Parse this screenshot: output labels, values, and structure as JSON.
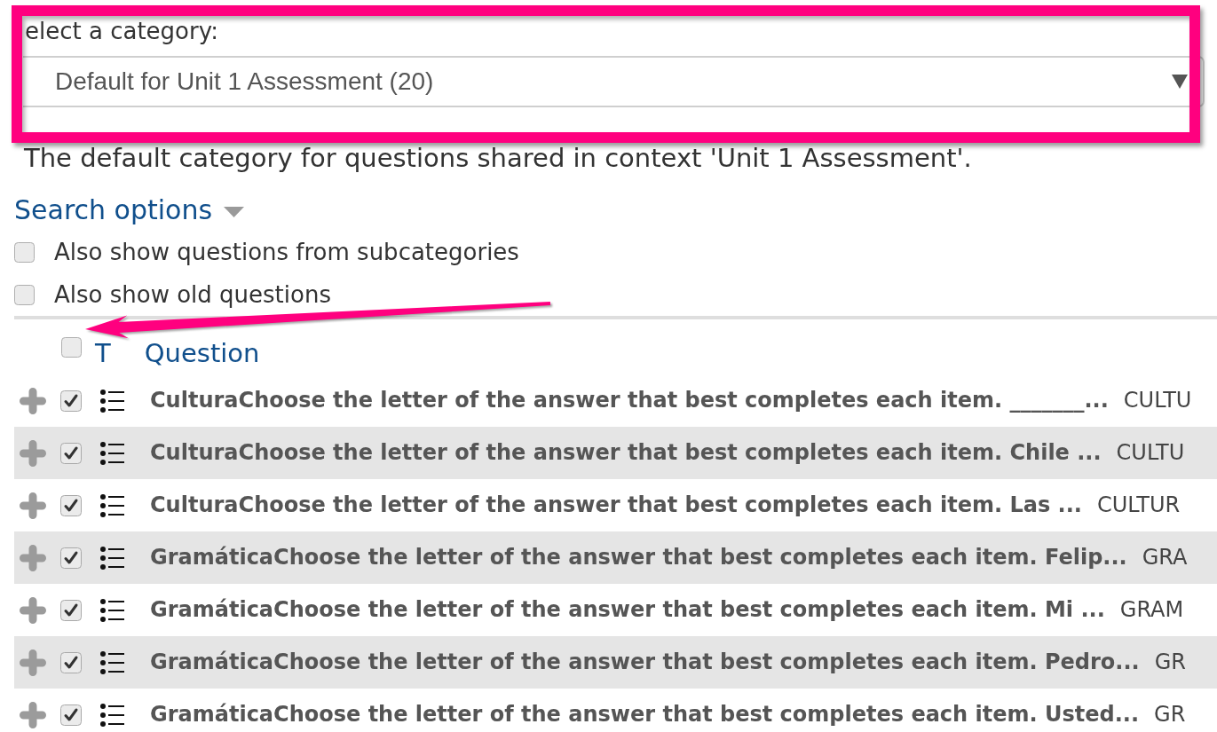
{
  "category_select": {
    "label": "elect a category:",
    "value": "Default for Unit 1 Assessment (20)",
    "highlighted": true
  },
  "category_description": "The default category for questions shared in context 'Unit 1 Assessment'.",
  "search_options": {
    "label": "Search options",
    "expanded": true,
    "options": [
      {
        "label": "Also show questions from subcategories",
        "checked": false
      },
      {
        "label": "Also show old questions",
        "checked": false
      }
    ]
  },
  "table": {
    "select_all_checked": false,
    "select_all_pointed_at": true,
    "columns": [
      "T",
      "Question"
    ],
    "rows": [
      {
        "question": "CulturaChoose the letter of the answer that best completes each item. _______...",
        "category": "CULTU",
        "checked": true
      },
      {
        "question": "CulturaChoose the letter of the answer that best completes each item. Chile ...",
        "category": "CULTU",
        "checked": true
      },
      {
        "question": "CulturaChoose the letter of the answer that best completes each item. Las ...",
        "category": "CULTUR",
        "checked": true
      },
      {
        "question": "GramáticaChoose the letter of the answer that best completes each item. Felip...",
        "category": "GRA",
        "checked": true
      },
      {
        "question": "GramáticaChoose the letter of the answer that best completes each item. Mi ...",
        "category": "GRAM",
        "checked": true
      },
      {
        "question": "GramáticaChoose the letter of the answer that best completes each item. Pedro...",
        "category": "GR",
        "checked": true
      },
      {
        "question": "GramáticaChoose the letter of the answer that best completes each item. Usted...",
        "category": "GR",
        "checked": true
      }
    ]
  }
}
